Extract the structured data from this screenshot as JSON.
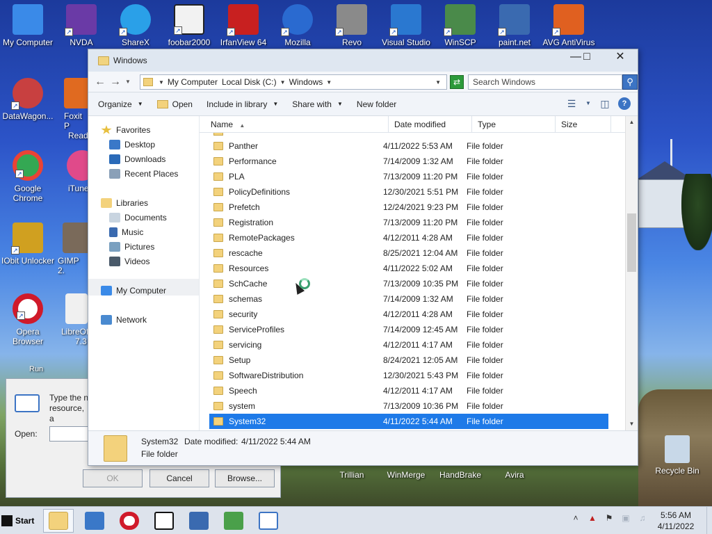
{
  "desktop": {
    "icons": [
      {
        "label": "My Computer",
        "color": "#3a8ae8",
        "icon": "computer-icon"
      },
      {
        "label": "NVDA",
        "color": "#6a3aa6",
        "icon": "nvda-icon"
      },
      {
        "label": "ShareX",
        "color": "#2aa0e8",
        "icon": "sharex-icon"
      },
      {
        "label": "foobar2000",
        "color": "#222222",
        "icon": "foobar-icon"
      },
      {
        "label": "IrfanView 64",
        "color": "#c82020",
        "icon": "irfanview-icon"
      },
      {
        "label": "Mozilla",
        "color": "#2a6ad0",
        "icon": "thunderbird-icon"
      },
      {
        "label": "Revo",
        "color": "#8a8a8a",
        "icon": "revo-icon"
      },
      {
        "label": "Visual Studio",
        "color": "#2a78d0",
        "icon": "vscode-icon"
      },
      {
        "label": "WinSCP",
        "color": "#4a8a4a",
        "icon": "winscp-icon"
      },
      {
        "label": "paint.net",
        "color": "#3a6ab0",
        "icon": "paintnet-icon"
      },
      {
        "label": "AVG AntiVirus",
        "color": "#e06020",
        "icon": "avg-icon"
      },
      {
        "label": "DataWagon...",
        "color": "#c84040",
        "icon": "datawagon-icon"
      },
      {
        "label": "Foxit P",
        "color": "#e06a20",
        "icon": "foxit-icon"
      },
      {
        "label": "Reade",
        "color": "#e06a20",
        "icon": "foxit-icon"
      },
      {
        "label": "Google Chrome",
        "color": "#34a853",
        "icon": "chrome-icon"
      },
      {
        "label": "iTune",
        "color": "#e04a8a",
        "icon": "itunes-icon"
      },
      {
        "label": "IObit Unlocker",
        "color": "#d0a020",
        "icon": "iobit-icon"
      },
      {
        "label": "GIMP 2.",
        "color": "#7a6a5a",
        "icon": "gimp-icon"
      },
      {
        "label": "Opera Browser",
        "color": "#d01a2a",
        "icon": "opera-icon"
      },
      {
        "label": "LibreOf",
        "color": "#f0f0f0",
        "icon": "libreoffice-icon"
      },
      {
        "label": "7.3",
        "color": "#f0f0f0",
        "icon": "libreoffice-icon"
      },
      {
        "label": "Run",
        "color": "#3a6ab0",
        "icon": "run-icon"
      },
      {
        "label": "Trillian",
        "color": "#2a5aa0",
        "icon": "trillian-icon"
      },
      {
        "label": "WinMerge",
        "color": "#e0c020",
        "icon": "winmerge-icon"
      },
      {
        "label": "HandBrake",
        "color": "#d06020",
        "icon": "handbrake-icon"
      },
      {
        "label": "Avira",
        "color": "#d02020",
        "icon": "avira-icon"
      },
      {
        "label": "Recycle Bin",
        "color": "#c8d8e8",
        "icon": "recycle-bin-icon"
      }
    ]
  },
  "explorer": {
    "title": "Windows",
    "address": [
      "My Computer",
      "Local Disk (C:)",
      "Windows"
    ],
    "search_placeholder": "Search Windows",
    "toolbar": {
      "organize": "Organize",
      "open": "Open",
      "include_in_library": "Include in library",
      "share_with": "Share with",
      "new_folder": "New folder"
    },
    "nav": {
      "favorites": "Favorites",
      "desktop": "Desktop",
      "downloads": "Downloads",
      "recent_places": "Recent Places",
      "libraries": "Libraries",
      "documents": "Documents",
      "music": "Music",
      "pictures": "Pictures",
      "videos": "Videos",
      "my_computer": "My Computer",
      "network": "Network"
    },
    "columns": {
      "name": "Name",
      "date_modified": "Date modified",
      "type": "Type",
      "size": "Size"
    },
    "rows": [
      {
        "name": "Panther",
        "date": "4/11/2022 5:53 AM",
        "type": "File folder"
      },
      {
        "name": "Performance",
        "date": "7/14/2009 1:32 AM",
        "type": "File folder"
      },
      {
        "name": "PLA",
        "date": "7/13/2009 11:20 PM",
        "type": "File folder"
      },
      {
        "name": "PolicyDefinitions",
        "date": "12/30/2021 5:51 PM",
        "type": "File folder"
      },
      {
        "name": "Prefetch",
        "date": "12/24/2021 9:23 PM",
        "type": "File folder"
      },
      {
        "name": "Registration",
        "date": "7/13/2009 11:20 PM",
        "type": "File folder"
      },
      {
        "name": "RemotePackages",
        "date": "4/12/2011 4:28 AM",
        "type": "File folder"
      },
      {
        "name": "rescache",
        "date": "8/25/2021 12:04 AM",
        "type": "File folder"
      },
      {
        "name": "Resources",
        "date": "4/11/2022 5:02 AM",
        "type": "File folder"
      },
      {
        "name": "SchCache",
        "date": "7/13/2009 10:35 PM",
        "type": "File folder"
      },
      {
        "name": "schemas",
        "date": "7/14/2009 1:32 AM",
        "type": "File folder"
      },
      {
        "name": "security",
        "date": "4/12/2011 4:28 AM",
        "type": "File folder"
      },
      {
        "name": "ServiceProfiles",
        "date": "7/14/2009 12:45 AM",
        "type": "File folder"
      },
      {
        "name": "servicing",
        "date": "4/12/2011 4:17 AM",
        "type": "File folder"
      },
      {
        "name": "Setup",
        "date": "8/24/2021 12:05 AM",
        "type": "File folder"
      },
      {
        "name": "SoftwareDistribution",
        "date": "12/30/2021 5:43 PM",
        "type": "File folder"
      },
      {
        "name": "Speech",
        "date": "4/12/2011 4:17 AM",
        "type": "File folder"
      },
      {
        "name": "system",
        "date": "7/13/2009 10:36 PM",
        "type": "File folder"
      },
      {
        "name": "System32",
        "date": "4/11/2022 5:44 AM",
        "type": "File folder",
        "selected": true
      }
    ],
    "details": {
      "name": "System32",
      "modified_label": "Date modified:",
      "modified_value": "4/11/2022 5:44 AM",
      "type": "File folder"
    }
  },
  "run_dialog": {
    "text": "Type the n resource, a",
    "open_label": "Open:",
    "ok": "OK",
    "cancel": "Cancel",
    "browse": "Browse..."
  },
  "taskbar": {
    "start": "Start",
    "time": "5:56 AM",
    "date": "4/11/2022"
  }
}
